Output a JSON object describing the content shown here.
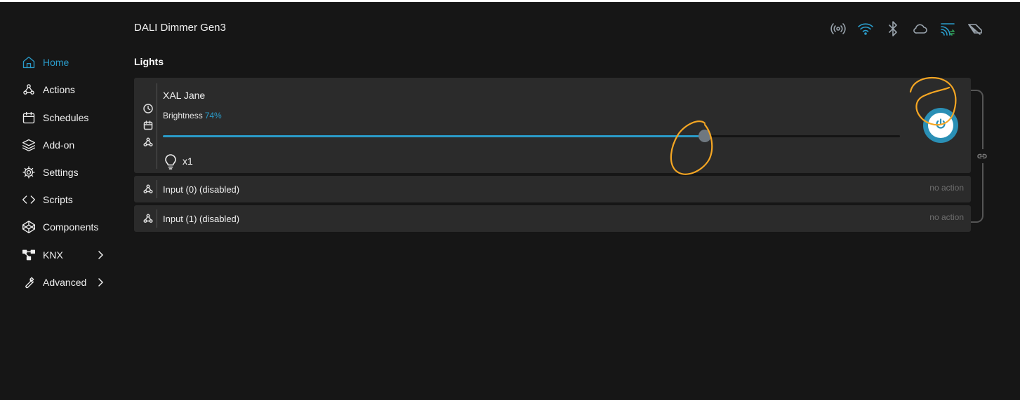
{
  "header": {
    "device_title": "DALI Dimmer Gen3",
    "status_icons": [
      {
        "name": "broadcast-icon",
        "state": "off"
      },
      {
        "name": "wifi-icon",
        "state": "on"
      },
      {
        "name": "bluetooth-icon",
        "state": "off"
      },
      {
        "name": "cloud-icon",
        "state": "off"
      },
      {
        "name": "mqtt-icon",
        "state": "on"
      },
      {
        "name": "debug-icon",
        "state": "off"
      }
    ]
  },
  "sidebar": {
    "items": [
      {
        "label": "Home",
        "icon": "home-icon",
        "active": true
      },
      {
        "label": "Actions",
        "icon": "webhook-icon"
      },
      {
        "label": "Schedules",
        "icon": "calendar-icon"
      },
      {
        "label": "Add-on",
        "icon": "layers-icon"
      },
      {
        "label": "Settings",
        "icon": "gear-icon"
      },
      {
        "label": "Scripts",
        "icon": "code-icon"
      },
      {
        "label": "Components",
        "icon": "codepen-icon"
      },
      {
        "label": "KNX",
        "icon": "knx-icon",
        "has_submenu": true
      },
      {
        "label": "Advanced",
        "icon": "wrench-icon",
        "has_submenu": true
      }
    ]
  },
  "lights": {
    "section_title": "Lights",
    "light": {
      "name": "XAL Jane",
      "brightness_label": "Brightness",
      "brightness_value": "74%",
      "brightness_fraction": 0.735,
      "count": "x1",
      "power_state": "on"
    },
    "inputs": [
      {
        "label": "Input (0) (disabled)",
        "action": "no action"
      },
      {
        "label": "Input (1) (disabled)",
        "action": "no action"
      }
    ]
  },
  "colors": {
    "accent": "#2a9bc9",
    "annotation": "#f5a623",
    "background": "#161616",
    "card": "#2b2b2b"
  }
}
